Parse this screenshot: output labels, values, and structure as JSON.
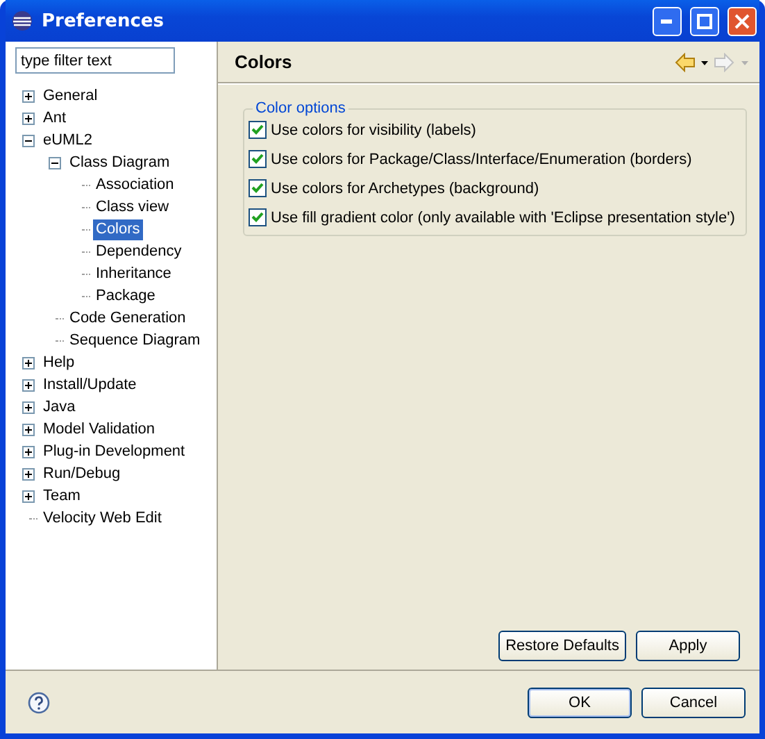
{
  "window": {
    "title": "Preferences"
  },
  "filter": {
    "placeholder": "type filter text"
  },
  "tree": [
    {
      "label": "General",
      "expanded": false,
      "selected": false
    },
    {
      "label": "Ant",
      "expanded": false,
      "selected": false
    },
    {
      "label": "eUML2",
      "expanded": true,
      "selected": false,
      "children": [
        {
          "label": "Class Diagram",
          "expanded": true,
          "selected": false,
          "children": [
            {
              "label": "Association",
              "selected": false
            },
            {
              "label": "Class view",
              "selected": false
            },
            {
              "label": "Colors",
              "selected": true
            },
            {
              "label": "Dependency",
              "selected": false
            },
            {
              "label": "Inheritance",
              "selected": false
            },
            {
              "label": "Package",
              "selected": false
            }
          ]
        },
        {
          "label": "Code Generation",
          "selected": false
        },
        {
          "label": "Sequence Diagram",
          "selected": false
        }
      ]
    },
    {
      "label": "Help",
      "expanded": false,
      "selected": false
    },
    {
      "label": "Install/Update",
      "expanded": false,
      "selected": false
    },
    {
      "label": "Java",
      "expanded": false,
      "selected": false
    },
    {
      "label": "Model Validation",
      "expanded": false,
      "selected": false
    },
    {
      "label": "Plug-in Development",
      "expanded": false,
      "selected": false
    },
    {
      "label": "Run/Debug",
      "expanded": false,
      "selected": false
    },
    {
      "label": "Team",
      "expanded": false,
      "selected": false
    },
    {
      "label": "Velocity Web Edit",
      "selected": false
    }
  ],
  "page": {
    "title": "Colors",
    "group": {
      "title": "Color options",
      "options": [
        {
          "label": "Use colors for visibility (labels)",
          "checked": true
        },
        {
          "label": "Use colors for Package/Class/Interface/Enumeration (borders)",
          "checked": true
        },
        {
          "label": "Use colors for Archetypes (background)",
          "checked": true
        },
        {
          "label": "Use fill gradient color (only available with 'Eclipse presentation style')",
          "checked": true
        }
      ]
    },
    "buttons": [
      "Restore Defaults",
      "Apply"
    ]
  },
  "buttons": [
    "OK",
    "Cancel"
  ]
}
